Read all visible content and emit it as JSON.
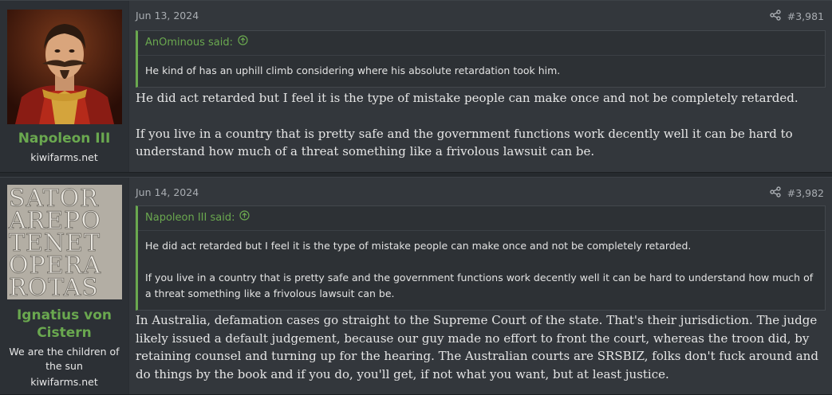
{
  "posts": [
    {
      "date": "Jun 13, 2024",
      "number": "#3,981",
      "author": {
        "name": "Napoleon III",
        "title": "kiwifarms.net"
      },
      "quote": {
        "attribution": "AnOminous said:",
        "paragraphs": [
          "He kind of has an uphill climb considering where his absolute retardation took him."
        ]
      },
      "body": [
        "He did act retarded but I feel it is the type of mistake people can make once and not be completely retarded.",
        "If you live in a country that is pretty safe and the government functions work decently well it can be hard to understand how much of a threat something like a frivolous lawsuit can be."
      ]
    },
    {
      "date": "Jun 14, 2024",
      "number": "#3,982",
      "author": {
        "name": "Ignatius von Cistern",
        "title": "We are the children of the sun",
        "site": "kiwifarms.net"
      },
      "quote": {
        "attribution": "Napoleon III said:",
        "paragraphs": [
          "He did act retarded but I feel it is the type of mistake people can make once and not be completely retarded.",
          "If you live in a country that is pretty safe and the government functions work decently well it can be hard to understand how much of a threat something like a frivolous lawsuit can be."
        ]
      },
      "body": [
        "In Australia, defamation cases go straight to the Supreme Court of the state. That's their jurisdiction. The judge likely issued a default judgement, because our guy made no effort to front the court, whereas the troon did, by retaining counsel and turning up for the hearing. The Australian courts are SRSBIZ, folks don't fuck around and do things by the book and if you do, you'll get, if not what you want, but at least justice."
      ]
    }
  ],
  "avatar2_letters": [
    "SATOR",
    "AREPO",
    "TENET",
    "OPERA",
    "ROTAS"
  ],
  "icons": {
    "share": "share-icon",
    "quote_jump": "arrow-up-circle-icon"
  },
  "colors": {
    "accent": "#6aa84f",
    "background": "#262a2e",
    "post": "#33373c"
  }
}
